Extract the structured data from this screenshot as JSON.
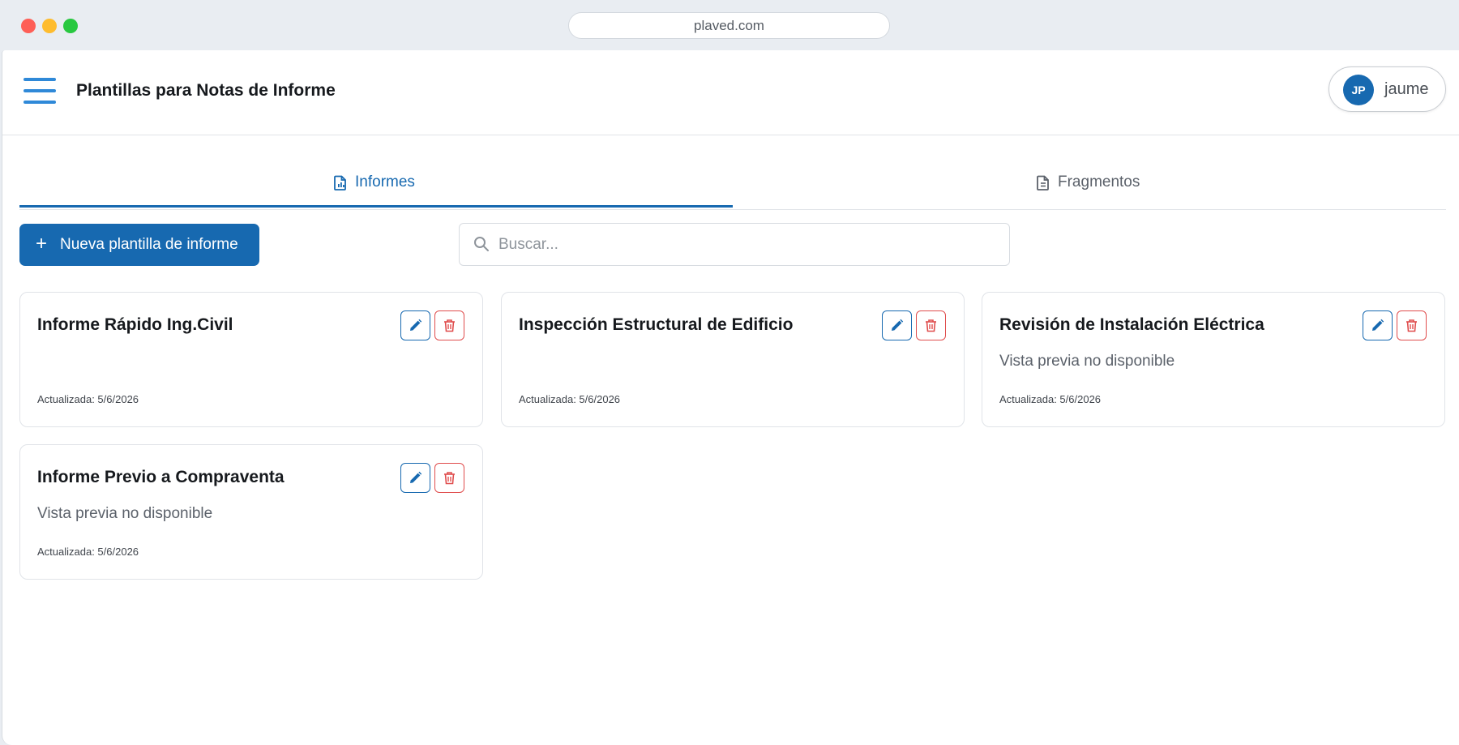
{
  "browser": {
    "url": "plaved.com"
  },
  "header": {
    "title": "Plantillas para Notas de Informe",
    "user": {
      "initials": "JP",
      "name": "jaume"
    }
  },
  "tabs": [
    {
      "label": "Informes",
      "icon": "report-icon",
      "active": true
    },
    {
      "label": "Fragmentos",
      "icon": "document-icon",
      "active": false
    }
  ],
  "toolbar": {
    "new_label": "Nueva plantilla de informe",
    "search_placeholder": "Buscar..."
  },
  "cards": [
    {
      "title": "Informe Rápido Ing.Civil",
      "preview": "",
      "updated": "Actualizada: 5/6/2026"
    },
    {
      "title": "Inspección Estructural de Edificio",
      "preview": "",
      "updated": "Actualizada: 5/6/2026"
    },
    {
      "title": "Revisión de Instalación Eléctrica",
      "preview": "Vista previa no disponible",
      "updated": "Actualizada: 5/6/2026"
    },
    {
      "title": "Informe Previo a Compraventa",
      "preview": "Vista previa no disponible",
      "updated": "Actualizada: 5/6/2026"
    }
  ],
  "colors": {
    "primary": "#1769b0",
    "danger": "#e04d4d",
    "menu_icon": "#2f89d8"
  }
}
